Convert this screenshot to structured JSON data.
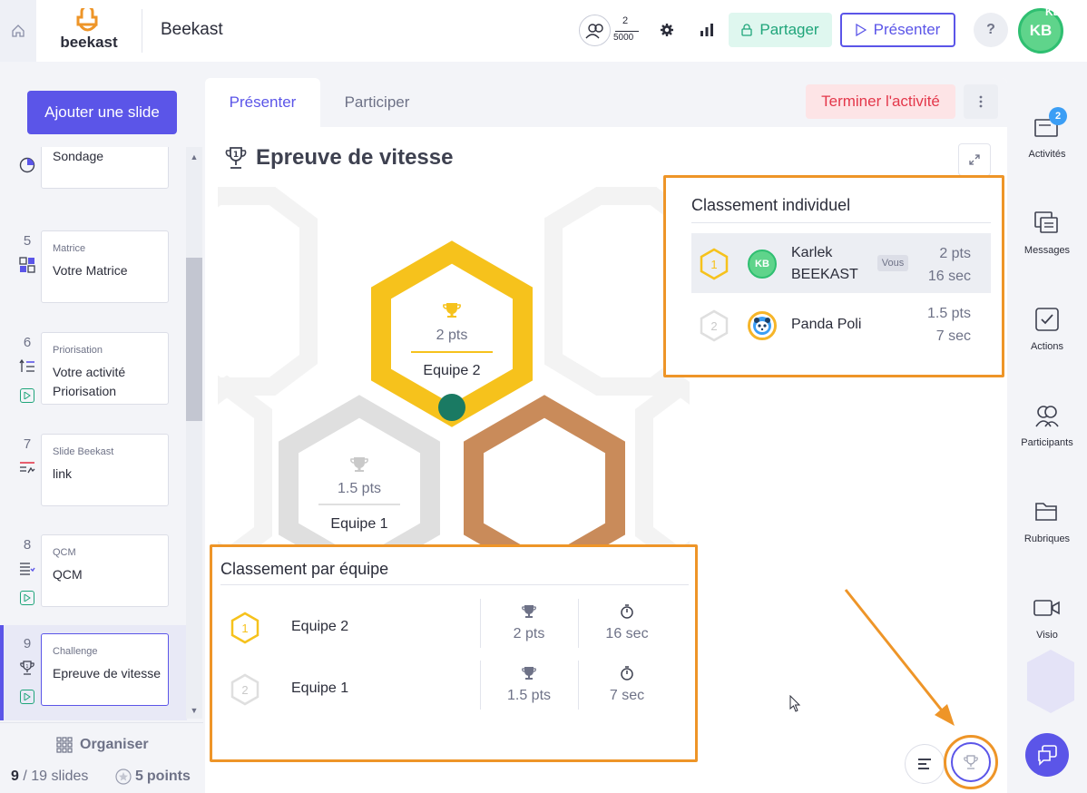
{
  "app": {
    "name": "Beekast",
    "logo_text": "beekast"
  },
  "topbar": {
    "participants_current": "2",
    "participants_max": "5000",
    "share_label": "Partager",
    "present_label": "Présenter",
    "help_label": "?",
    "avatar_initials": "KB",
    "avatar_badge": "KB"
  },
  "sidebar": {
    "add_slide_label": "Ajouter une slide",
    "slides": [
      {
        "num": "",
        "type": "Sondage",
        "title": "Sondage",
        "icon": "pie-chart-icon",
        "play": false
      },
      {
        "num": "5",
        "type": "Matrice",
        "title": "Votre Matrice",
        "icon": "matrix-icon",
        "play": false
      },
      {
        "num": "6",
        "type": "Priorisation",
        "title": "Votre activité Priorisation",
        "icon": "prioritization-icon",
        "play": true
      },
      {
        "num": "7",
        "type": "Slide Beekast",
        "title": "link",
        "icon": "slide-icon",
        "play": false
      },
      {
        "num": "8",
        "type": "QCM",
        "title": "QCM",
        "icon": "checklist-icon",
        "play": true
      },
      {
        "num": "9",
        "type": "Challenge",
        "title": "Epreuve de vitesse",
        "icon": "trophy-icon",
        "play": true,
        "active": true
      }
    ],
    "organise_label": "Organiser",
    "slides_current": "9",
    "slides_total_label": "/ 19 slides",
    "points_value": "5",
    "points_label": "points"
  },
  "main": {
    "tabs": [
      {
        "label": "Présenter",
        "active": true
      },
      {
        "label": "Participer",
        "active": false
      }
    ],
    "end_activity_label": "Terminer l'activité",
    "activity_title": "Epreuve de vitesse",
    "activity_rank_badge": "1",
    "podium": [
      {
        "place": 1,
        "pts": "2 pts",
        "team": "Equipe 2",
        "dot_color": "#1a7a63",
        "frame_color": "#f6c21c"
      },
      {
        "place": 2,
        "pts": "1.5 pts",
        "team": "Equipe 1",
        "dot_color": "#e8c30e",
        "frame_color": "#dfdfdf"
      },
      {
        "place": 3,
        "pts": "",
        "team": "",
        "dot_color": "",
        "frame_color": "#c98b5a"
      }
    ],
    "individual": {
      "title": "Classement individuel",
      "rows": [
        {
          "rank": "1",
          "initials": "KB",
          "name": "Karlek BEEKAST",
          "you": "Vous",
          "pts": "2 pts",
          "time": "16 sec"
        },
        {
          "rank": "2",
          "initials": "",
          "name": "Panda Poli",
          "you": "",
          "pts": "1.5 pts",
          "time": "7 sec"
        }
      ]
    },
    "teams": {
      "title": "Classement par équipe",
      "rows": [
        {
          "rank": "1",
          "name": "Equipe 2",
          "pts": "2 pts",
          "time": "16 sec"
        },
        {
          "rank": "2",
          "name": "Equipe 1",
          "pts": "1.5 pts",
          "time": "7 sec"
        }
      ]
    }
  },
  "rightbar": {
    "items": [
      {
        "label": "Activités",
        "icon": "activities-icon",
        "badge": "2"
      },
      {
        "label": "Messages",
        "icon": "messages-icon",
        "badge": ""
      },
      {
        "label": "Actions",
        "icon": "actions-icon",
        "badge": ""
      },
      {
        "label": "Participants",
        "icon": "participants-icon",
        "badge": ""
      },
      {
        "label": "Rubriques",
        "icon": "folder-icon",
        "badge": ""
      },
      {
        "label": "Visio",
        "icon": "video-icon",
        "badge": ""
      }
    ]
  },
  "colors": {
    "accent": "#5b55e8",
    "highlight_outline": "#ee9528",
    "gold": "#f6c21c",
    "silver": "#dfdfdf",
    "bronze": "#c98b5a",
    "success": "#1fa57a",
    "danger": "#e4384b"
  }
}
